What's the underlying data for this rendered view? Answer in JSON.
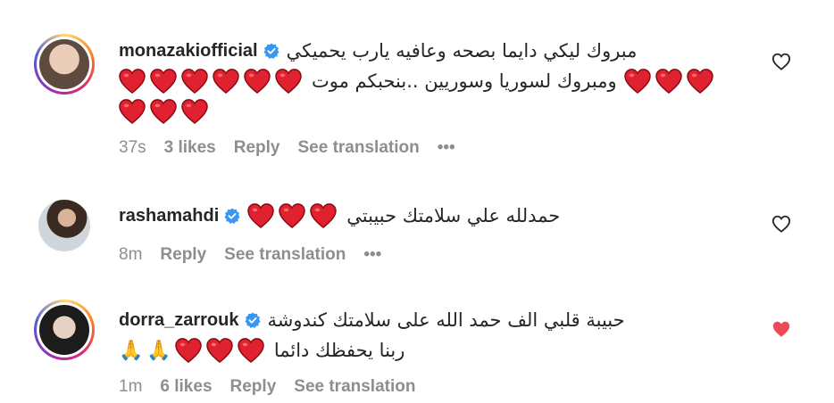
{
  "comments": [
    {
      "username": "monazakiofficial",
      "text_line1": "مبروك ليكي دايما بصحه وعافيه يارب يحميكي",
      "text_line2": "ومبروك لسوريا وسوريين ..بنحبكم موت",
      "time": "37s",
      "likes": "3 likes",
      "reply": "Reply",
      "translate": "See translation",
      "more": "•••",
      "liked": false
    },
    {
      "username": "rashamahdi",
      "text_line1": "حمدلله علي سلامتك حبيبتي",
      "time": "8m",
      "reply": "Reply",
      "translate": "See translation",
      "more": "•••",
      "liked": false
    },
    {
      "username": "dorra_zarrouk",
      "text_line1": "حبيبة قلبي الف حمد الله على سلامتك كندوشة",
      "text_line2": "ربنا يحفظك دائما",
      "time": "1m",
      "likes": "6 likes",
      "reply": "Reply",
      "translate": "See translation",
      "liked": true
    }
  ],
  "colors": {
    "heart_emoji": "#e0212f",
    "verified": "#3897f0",
    "liked": "#ed4956",
    "meta": "#8e8e8e"
  },
  "icons": [
    "verified-badge-icon",
    "heart-emoji-icon",
    "folded-hands-emoji-icon",
    "like-heart-icon",
    "more-options-icon"
  ]
}
